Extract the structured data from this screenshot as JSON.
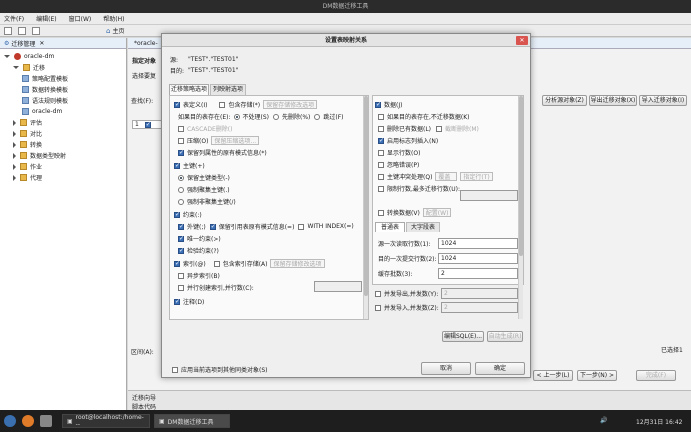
{
  "window": {
    "title": "DM数据迁移工具"
  },
  "menu": [
    "文件(F)",
    "编辑(E)",
    "窗口(W)",
    "帮助(H)"
  ],
  "toolbar": {
    "home_label": "主页"
  },
  "left_panel": {
    "tab_label": "迁移管理",
    "tree": [
      {
        "label": "oracle-dm",
        "icon": "database-icon",
        "level": 0
      },
      {
        "label": "迁移",
        "icon": "folder-icon",
        "level": 1
      },
      {
        "label": "策略配置模板",
        "icon": "template-icon",
        "level": 2
      },
      {
        "label": "数据转换模板",
        "icon": "template-icon",
        "level": 2
      },
      {
        "label": "语法规则模板",
        "icon": "template-icon",
        "level": 2
      },
      {
        "label": "oracle-dm",
        "icon": "migration-icon",
        "level": 2
      },
      {
        "label": "评估",
        "icon": "folder-icon",
        "level": 1
      },
      {
        "label": "对比",
        "icon": "folder-icon",
        "level": 1
      },
      {
        "label": "转换",
        "icon": "folder-icon",
        "level": 1
      },
      {
        "label": "数据类型映射",
        "icon": "folder-icon",
        "level": 1
      },
      {
        "label": "作业",
        "icon": "folder-icon",
        "level": 1
      },
      {
        "label": "代理",
        "icon": "folder-icon",
        "level": 1
      }
    ]
  },
  "main": {
    "tab_label": "*oracle-",
    "section_title": "指定对象",
    "section_desc": "选择要复",
    "search_label": "查找(F):",
    "table_row_num": "1",
    "buttons": {
      "analyze": "分析源对象(Z)",
      "export": "导出迁移对象(X)",
      "import": "导入迁移对象(I)"
    },
    "zone_label": "区间(A):",
    "selected_status": "已选择1",
    "prev": "< 上一步(L)",
    "next": "下一步(N) >",
    "finish": "完成(F)",
    "bottom_tabs": [
      "迁移向导",
      "脚本代码"
    ]
  },
  "dialog": {
    "title": "设置表映射关系",
    "source_label": "源:",
    "source_value": "\"TEST\".\"TEST01\"",
    "target_label": "目的:",
    "target_value": "\"TEST\".\"TEST01\"",
    "tabs": [
      "迁移策略选项",
      "列映射选项"
    ],
    "left": {
      "table_def": "表定义(I)",
      "contains_storage": "包含存储(*)",
      "keep_storage_options": "保留存储修改选项",
      "if_exists": "如果目的表存在(E):",
      "if_exists_options": [
        "不处理(S)",
        "先删除(%)",
        "跳过(F)"
      ],
      "cascade": "CASCADE删除()",
      "compress": "压缩(O)",
      "keep_compress_options": "保留压缩选项...",
      "keep_attr_info": "保留列属性的原有模式信息(*)",
      "primary_key": "主键(+)",
      "pk_options": [
        "保留主键类型(-)",
        "强制聚集主键(.)",
        "强制非聚集主键(/)"
      ],
      "constraint": "约束(:)",
      "foreign_key": "外键(;)",
      "keep_ref_schema": "保留引用表原有模式信息(=)",
      "with_index": "WITH INDEX(=)",
      "unique": "唯一约束(>)",
      "check": "检验约束(?)",
      "index": "索引(@)",
      "index_storage": "包含索引存储(A)",
      "keep_index_storage": "保留存储修改选项",
      "reverse_index": "异步索引(B)",
      "parallel_index": "并行创建索引,并行数(C):",
      "comment": "注释(D)"
    },
    "right": {
      "data": "数据(J)",
      "no_migrate_if_exists": "如果目的表存在,不迁移数据(K)",
      "delete_existing": "删除已有数据(L)",
      "truncate_table": "截断删除(M)",
      "enable_identity": "启用标志列插入(N)",
      "show_rows": "显示行数(O)",
      "ignore_errors": "忽略错误(P)",
      "pk_conflict": "主键冲突处理(Q)",
      "pk_conflict_sel": "覆盖",
      "custom_rows": "指定行(T)",
      "limit_rows": "限制行数,最多迁移行数(U):",
      "convert_data": "转换数据(V)",
      "convert_config": "配置(W)",
      "subtabs": [
        "普通表",
        "大字段表"
      ],
      "read_rows_label": "源一次读取行数(1):",
      "read_rows": "1024",
      "commit_rows_label": "目的一次提交行数(2):",
      "commit_rows": "1024",
      "batch_label": "缓存批数(3):",
      "batch": "2",
      "parallel_export": "并发导出,并发数(Y):",
      "parallel_export_val": "2",
      "parallel_import": "并发导入,并发数(Z):",
      "parallel_import_val": "2",
      "edit_sql": "编辑SQL(E)...",
      "auto_gen": "自动生成(R)"
    },
    "apply_same": "应用当前选项到其他同类对象(S)",
    "cancel": "取消",
    "ok": "确定"
  },
  "taskbar": {
    "items": [
      "root@localhost:/home---",
      "DM数据迁移工具"
    ],
    "date": "12月31日 16:42"
  }
}
